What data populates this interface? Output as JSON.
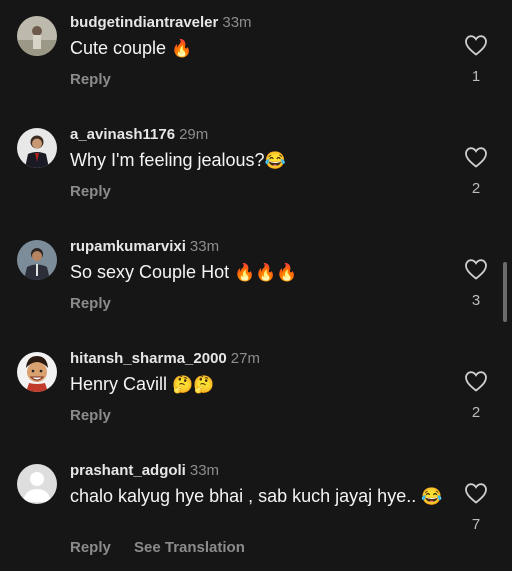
{
  "comments": [
    {
      "username": "budgetindiantraveler",
      "time": "33m",
      "text": "Cute couple ",
      "emoji": "🔥",
      "reply": "Reply",
      "likes": "1"
    },
    {
      "username": "a_avinash1176",
      "time": "29m",
      "text": "Why I'm feeling jealous?",
      "emoji": "😂",
      "reply": "Reply",
      "likes": "2"
    },
    {
      "username": "rupamkumarvixi",
      "time": "33m",
      "text": "So sexy Couple Hot ",
      "emoji": "🔥🔥🔥",
      "reply": "Reply",
      "likes": "3"
    },
    {
      "username": "hitansh_sharma_2000",
      "time": "27m",
      "text": "Henry Cavill ",
      "emoji": "🤔🤔",
      "reply": "Reply",
      "likes": "2"
    },
    {
      "username": "prashant_adgoli",
      "time": "33m",
      "text": "chalo kalyug hye bhai , sab kuch jayaj hye.. ",
      "emoji": "😂",
      "reply": "Reply",
      "translate": "See Translation",
      "likes": "7"
    }
  ],
  "icons": {
    "like": "heart-outline-icon",
    "avatar": "user-avatar"
  }
}
